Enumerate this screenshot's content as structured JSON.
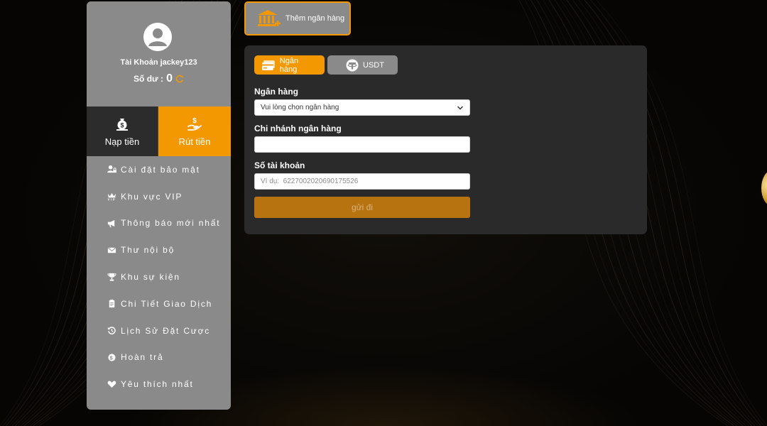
{
  "sidebar": {
    "username": "Tài Khoản jackey123",
    "balance_label": "Số dư :",
    "balance_value": "0",
    "icons": {
      "avatar": "user-avatar-icon",
      "refresh": "refresh-icon"
    },
    "actions": [
      {
        "label": "Nạp tiền",
        "icon": "money-bag-icon"
      },
      {
        "label": "Rút tiền",
        "icon": "hand-dollar-icon"
      }
    ],
    "menu": [
      {
        "label": "Cài đặt bảo mật",
        "icon": "user-lock-icon"
      },
      {
        "label": "Khu vực VIP",
        "icon": "crown-vip-icon"
      },
      {
        "label": "Thông báo mới nhất",
        "icon": "megaphone-icon"
      },
      {
        "label": "Thư nội bộ",
        "icon": "envelope-icon"
      },
      {
        "label": "Khu sự kiện",
        "icon": "trophy-icon"
      },
      {
        "label": "Chi Tiết Giao Dịch",
        "icon": "clipboard-icon"
      },
      {
        "label": "Lịch Sử Đặt Cược",
        "icon": "history-icon"
      },
      {
        "label": "Hoàn trả",
        "icon": "dollar-circle-icon"
      },
      {
        "label": "Yêu thích nhất",
        "icon": "heart-icon"
      }
    ]
  },
  "header": {
    "add_bank_label": "Thêm ngân hàng",
    "icon": "bank-plus-icon"
  },
  "panel": {
    "tabs": [
      {
        "label": "Ngân hàng",
        "icon": "bank-card-icon",
        "active": true
      },
      {
        "label": "USDT",
        "icon": "tether-icon",
        "active": false
      }
    ],
    "bank_label": "Ngân hàng",
    "bank_select_value": "Vui lòng chọn ngân hàng",
    "branch_label": "Chi nhánh ngân hàng",
    "branch_value": "",
    "account_label": "Số tài khoản",
    "account_placeholder": "Ví dụ:  6227002020690175526",
    "submit_label": "gửi đi"
  },
  "colors": {
    "accent": "#f39800",
    "panel": "#2a2a2a",
    "sidebar": "#8a8a8a",
    "submit": "#b7730f"
  }
}
